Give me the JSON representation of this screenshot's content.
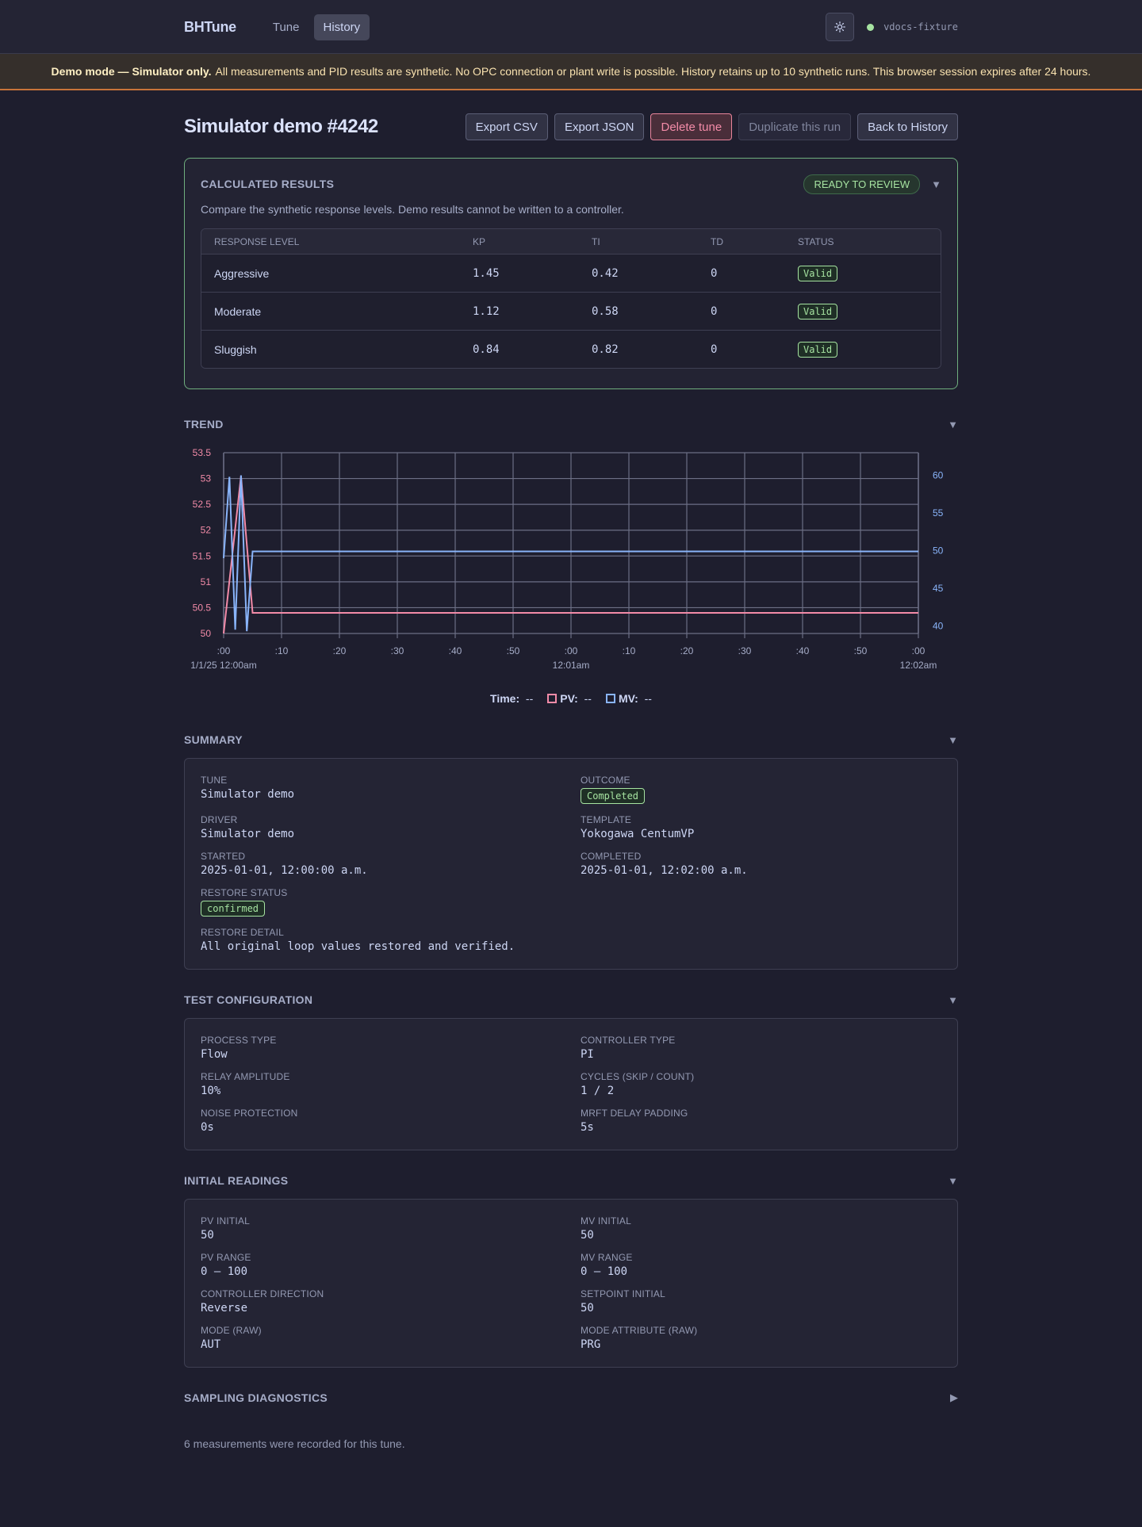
{
  "nav": {
    "brand": "BHTune",
    "links": [
      "Tune",
      "History"
    ],
    "active": "History",
    "env": "vdocs-fixture",
    "theme_icon": "sun-icon"
  },
  "banner": {
    "strong": "Demo mode — Simulator only.",
    "text": "All measurements and PID results are synthetic. No OPC connection or plant write is possible. History retains up to 10 synthetic runs. This browser session expires after 24 hours."
  },
  "page": {
    "title": "Simulator demo #4242",
    "actions": {
      "export_csv": "Export CSV",
      "export_json": "Export JSON",
      "delete": "Delete tune",
      "duplicate": "Duplicate this run",
      "back": "Back to History"
    }
  },
  "results": {
    "title": "CALCULATED RESULTS",
    "badge": "READY TO REVIEW",
    "subtitle": "Compare the synthetic response levels. Demo results cannot be written to a controller.",
    "columns": [
      "RESPONSE LEVEL",
      "KP",
      "TI",
      "TD",
      "STATUS"
    ],
    "rows": [
      {
        "level": "Aggressive",
        "kp": "1.45",
        "ti": "0.42",
        "td": "0",
        "status": "Valid"
      },
      {
        "level": "Moderate",
        "kp": "1.12",
        "ti": "0.58",
        "td": "0",
        "status": "Valid"
      },
      {
        "level": "Sluggish",
        "kp": "0.84",
        "ti": "0.82",
        "td": "0",
        "status": "Valid"
      }
    ]
  },
  "trend": {
    "title": "TREND",
    "legend": {
      "time_label": "Time:",
      "time_value": "--",
      "pv_label": "PV:",
      "pv_value": "--",
      "mv_label": "MV:",
      "mv_value": "--"
    }
  },
  "chart_data": {
    "type": "line",
    "x_unit": "seconds",
    "x_ticks": [
      ":00",
      ":10",
      ":20",
      ":30",
      ":40",
      ":50",
      ":00",
      ":10",
      ":20",
      ":30",
      ":40",
      ":50",
      ":00"
    ],
    "x_tick_values": [
      0,
      10,
      20,
      30,
      40,
      50,
      60,
      70,
      80,
      90,
      100,
      110,
      120
    ],
    "x_sublabels": [
      {
        "at": 0,
        "text": "1/1/25 12:00am"
      },
      {
        "at": 60,
        "text": "12:01am"
      },
      {
        "at": 120,
        "text": "12:02am"
      }
    ],
    "xlim": [
      0,
      120
    ],
    "y_left": {
      "ticks": [
        "50",
        "50.5",
        "51",
        "51.5",
        "52",
        "52.5",
        "53",
        "53.5"
      ],
      "tick_values": [
        50,
        50.5,
        51,
        51.5,
        52,
        52.5,
        53,
        53.5
      ],
      "lim": [
        50,
        53.5
      ],
      "color": "#f38ba8"
    },
    "y_right": {
      "ticks": [
        "40",
        "45",
        "50",
        "55",
        "60"
      ],
      "tick_values": [
        40,
        45,
        50,
        55,
        60
      ],
      "lim": [
        39,
        63
      ],
      "color": "#89b4fa"
    },
    "grid": true,
    "series": [
      {
        "name": "PV",
        "axis": "left",
        "color": "#f38ba8",
        "x": [
          0,
          3,
          5,
          120
        ],
        "y": [
          50,
          53.05,
          50.4,
          50.4
        ]
      },
      {
        "name": "MV",
        "axis": "right",
        "color": "#89b4fa",
        "x": [
          0,
          1,
          2,
          3,
          4,
          5,
          120
        ],
        "y": [
          49,
          59.8,
          39.5,
          60,
          39.3,
          49.9,
          49.9
        ]
      }
    ]
  },
  "summary": {
    "title": "SUMMARY",
    "fields": {
      "tune_label": "TUNE",
      "tune": "Simulator demo",
      "outcome_label": "OUTCOME",
      "outcome": "Completed",
      "driver_label": "DRIVER",
      "driver": "Simulator demo",
      "template_label": "TEMPLATE",
      "template": "Yokogawa CentumVP",
      "started_label": "STARTED",
      "started": "2025-01-01, 12:00:00 a.m.",
      "completed_label": "COMPLETED",
      "completed": "2025-01-01, 12:02:00 a.m.",
      "restore_status_label": "RESTORE STATUS",
      "restore_status": "confirmed",
      "restore_detail_label": "RESTORE DETAIL",
      "restore_detail": "All original loop values restored and verified."
    }
  },
  "test_config": {
    "title": "TEST CONFIGURATION",
    "fields": {
      "process_type_label": "PROCESS TYPE",
      "process_type": "Flow",
      "controller_type_label": "CONTROLLER TYPE",
      "controller_type": "PI",
      "relay_amplitude_label": "RELAY AMPLITUDE",
      "relay_amplitude": "10%",
      "cycles_label": "CYCLES (SKIP / COUNT)",
      "cycles": "1 / 2",
      "noise_label": "NOISE PROTECTION",
      "noise": "0s",
      "mrft_label": "MRFT DELAY PADDING",
      "mrft": "5s"
    }
  },
  "initial_readings": {
    "title": "INITIAL READINGS",
    "fields": {
      "pv_initial_label": "PV INITIAL",
      "pv_initial": "50",
      "mv_initial_label": "MV INITIAL",
      "mv_initial": "50",
      "pv_range_label": "PV RANGE",
      "pv_range": "0 – 100",
      "mv_range_label": "MV RANGE",
      "mv_range": "0 – 100",
      "direction_label": "CONTROLLER DIRECTION",
      "direction": "Reverse",
      "setpoint_label": "SETPOINT INITIAL",
      "setpoint": "50",
      "mode_label": "MODE (RAW)",
      "mode": "AUT",
      "mode_attr_label": "MODE ATTRIBUTE (RAW)",
      "mode_attr": "PRG"
    }
  },
  "diagnostics": {
    "title": "SAMPLING DIAGNOSTICS",
    "note": "6 measurements were recorded for this tune."
  }
}
